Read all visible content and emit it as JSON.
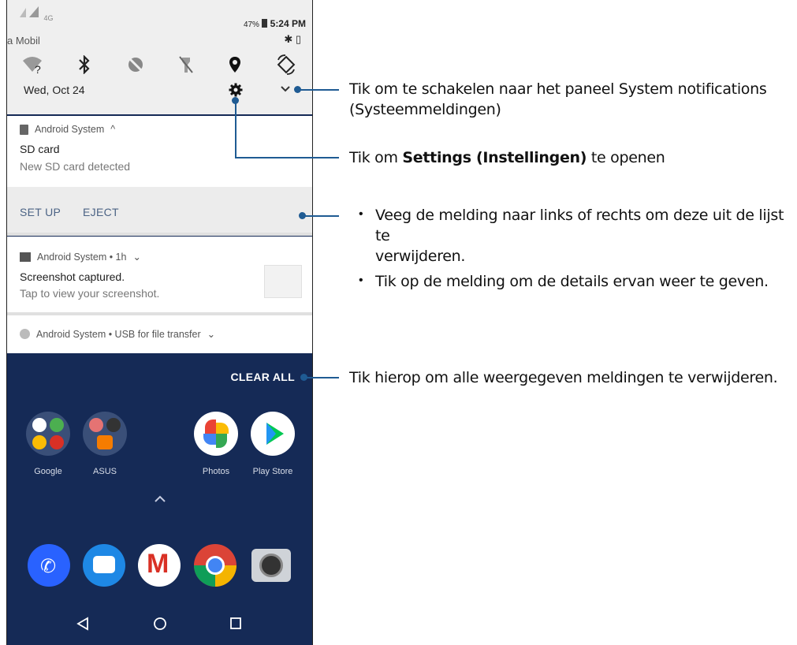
{
  "status_bar": {
    "left_label": "4G",
    "battery": "47%",
    "time": "5:24 PM",
    "carrier": "a Mobil"
  },
  "quick_settings": {
    "icons": [
      "wifi-icon",
      "bluetooth-icon",
      "do-not-disturb-icon",
      "flashlight-off-icon",
      "location-icon",
      "auto-rotate-icon"
    ],
    "date": "Wed, Oct 24"
  },
  "notifications": [
    {
      "app": "Android System",
      "app_suffix": "^",
      "title": "SD card",
      "text": "New SD card detected",
      "actions": [
        "SET UP",
        "EJECT"
      ]
    },
    {
      "app": "Android System • 1h",
      "title": "Screenshot captured.",
      "text": "Tap to view your screenshot."
    },
    {
      "app": "Android System • USB for file transfer"
    }
  ],
  "clear_all": "CLEAR ALL",
  "home": {
    "apps": [
      "Google",
      "ASUS",
      "Photos",
      "Play Store"
    ],
    "dock": [
      "phone-icon",
      "messages-icon",
      "gmail-icon",
      "chrome-icon",
      "camera-icon"
    ]
  },
  "callouts": {
    "c1_line1": "Tik om te schakelen naar het paneel System notifications",
    "c1_line2": "(Systeemmeldingen)",
    "c2_pre": "Tik om ",
    "c2_bold": "Settings (Instellingen)",
    "c2_post": " te openen",
    "c3_bullet1_line1": "Veeg de melding naar links of rechts om deze uit de lijst te",
    "c3_bullet1_line2": "verwijderen.",
    "c3_bullet2": "Tik op de melding om de details ervan weer te geven.",
    "c4": "Tik hierop om alle weergegeven meldingen te verwijderen."
  },
  "colors": {
    "accent_line": "#1f5b93",
    "home_bg": "#152a56"
  }
}
